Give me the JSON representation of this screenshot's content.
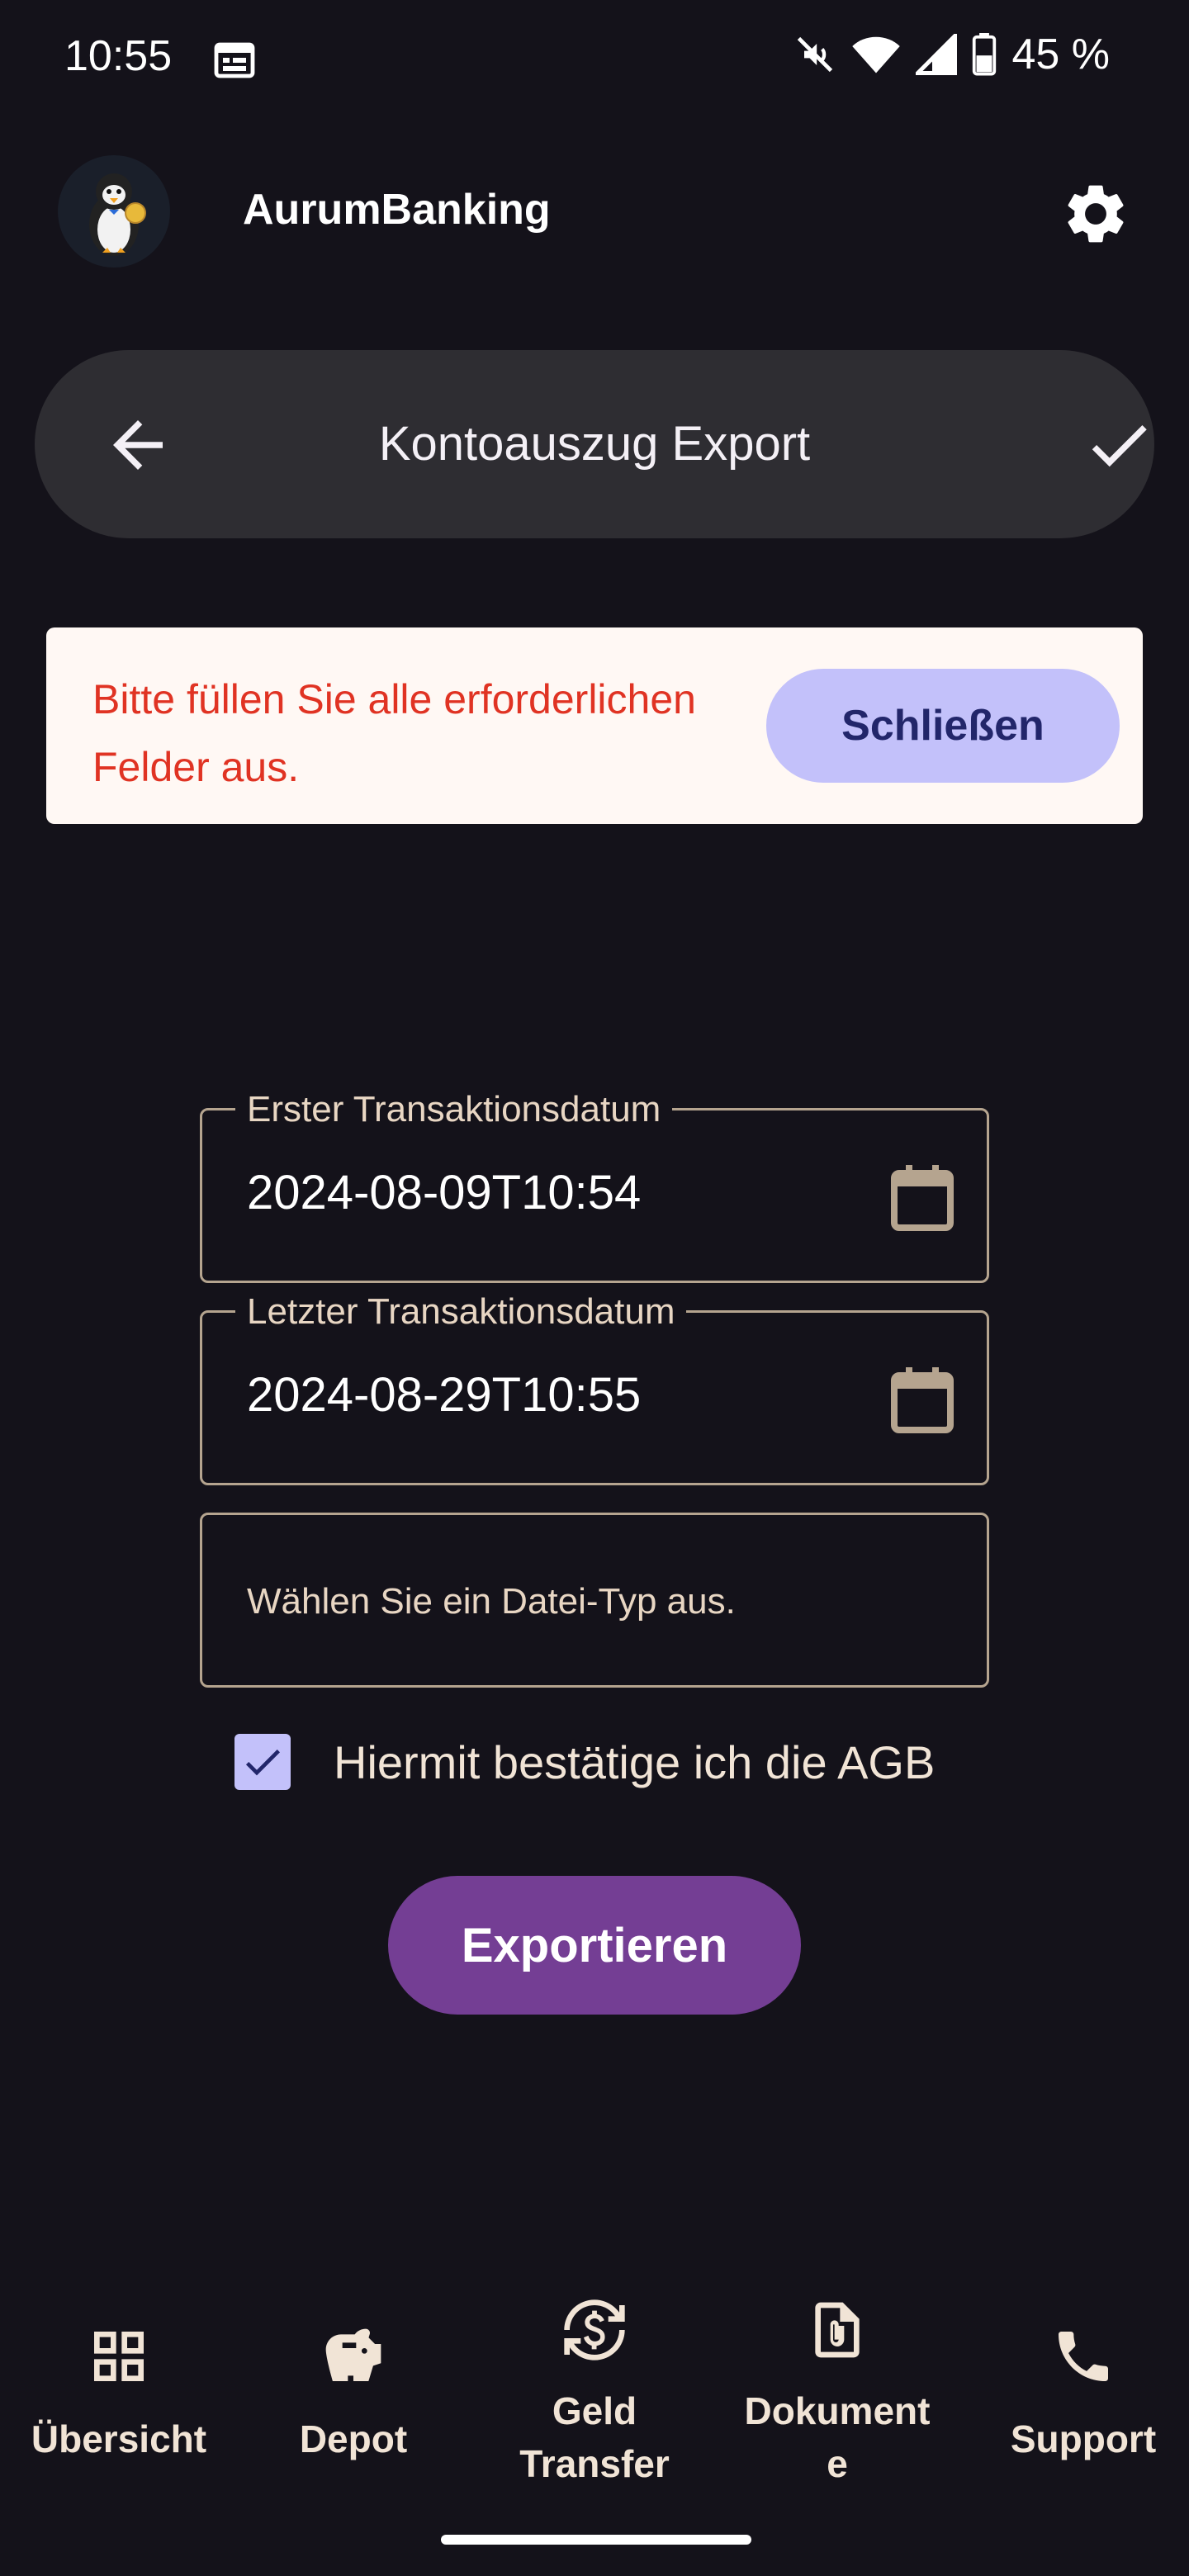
{
  "status_bar": {
    "time": "10:55",
    "battery": "45 %",
    "icons": [
      "calendar-icon",
      "mute-icon",
      "wifi-icon",
      "signal-icon",
      "battery-icon"
    ]
  },
  "app": {
    "title": "AurumBanking",
    "logo": "penguin-logo",
    "settings_icon": "gear-icon"
  },
  "header": {
    "title": "Kontoauszug Export",
    "back_icon": "arrow-back-icon",
    "confirm_icon": "check-icon"
  },
  "snackbar": {
    "message": "Bitte füllen Sie alle erforderlichen Felder aus.",
    "button_label": "Schließen",
    "text_color": "#e03323",
    "button_color": "#c3c1fa"
  },
  "form": {
    "first_date": {
      "label": "Erster Transaktionsdatum",
      "value": "2024-08-09T10:54"
    },
    "last_date": {
      "label": "Letzter Transaktionsdatum",
      "value": "2024-08-29T10:55"
    },
    "file_type": {
      "placeholder": "Wählen Sie ein Datei-Typ aus."
    },
    "agb": {
      "label": "Hiermit bestätige ich die AGB",
      "checked": true
    },
    "export_label": "Exportieren",
    "export_color": "#743e94"
  },
  "bottom_nav": {
    "items": [
      {
        "label": "Übersicht",
        "icon": "grid-icon"
      },
      {
        "label": "Depot",
        "icon": "piggy-bank-icon"
      },
      {
        "label": "Geld\nTransfer",
        "icon": "currency-exchange-icon"
      },
      {
        "label": "Dokument\ne",
        "icon": "document-attach-icon"
      },
      {
        "label": "Support",
        "icon": "phone-icon"
      }
    ]
  }
}
